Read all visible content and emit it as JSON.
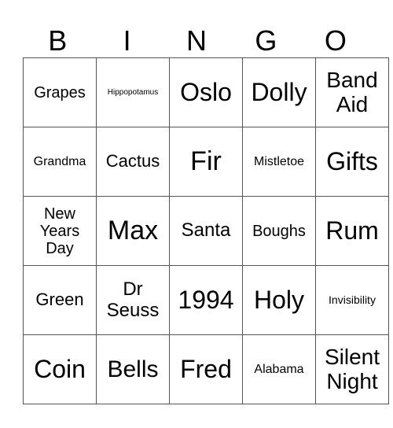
{
  "header": [
    "B",
    "I",
    "N",
    "G",
    "O"
  ],
  "rows": [
    [
      "Grapes",
      "Hippopotamus",
      "Oslo",
      "Dolly",
      "Band Aid"
    ],
    [
      "Grandma",
      "Cactus",
      "Fir",
      "Mistletoe",
      "Gifts"
    ],
    [
      "New Years Day",
      "Max",
      "Santa",
      "Boughs",
      "Rum"
    ],
    [
      "Green",
      "Dr Seuss",
      "1994",
      "Holy",
      "Invisibility"
    ],
    [
      "Coin",
      "Bells",
      "Fred",
      "Alabama",
      "Silent Night"
    ]
  ]
}
